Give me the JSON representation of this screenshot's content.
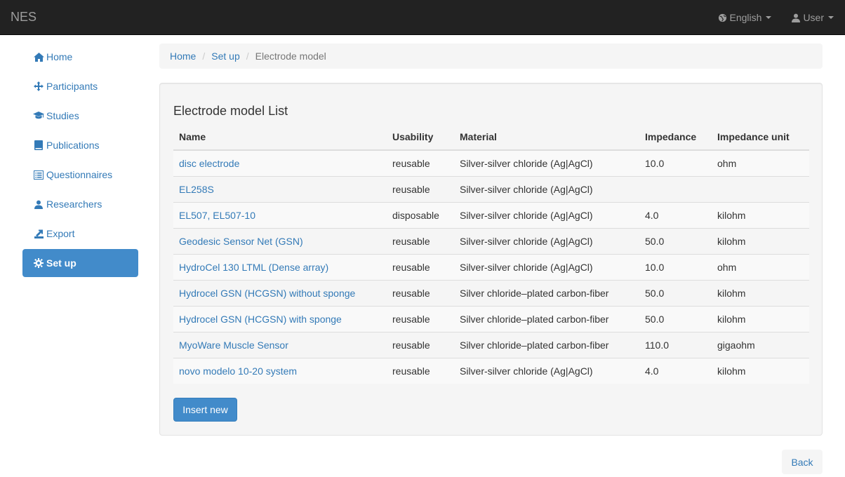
{
  "navbar": {
    "brand": "NES",
    "language_label": "English",
    "language_icon": "globe-icon",
    "user_label": "User",
    "user_icon": "user-icon"
  },
  "sidebar": {
    "items": [
      {
        "label": "Home",
        "icon": "home-icon"
      },
      {
        "label": "Participants",
        "icon": "move-icon"
      },
      {
        "label": "Studies",
        "icon": "education-icon"
      },
      {
        "label": "Publications",
        "icon": "book-icon"
      },
      {
        "label": "Questionnaires",
        "icon": "list-alt-icon"
      },
      {
        "label": "Researchers",
        "icon": "user-icon"
      },
      {
        "label": "Export",
        "icon": "export-icon"
      },
      {
        "label": "Set up",
        "icon": "cog-icon",
        "active": true
      }
    ]
  },
  "breadcrumb": {
    "items": [
      "Home",
      "Set up"
    ],
    "current": "Electrode model"
  },
  "list": {
    "title": "Electrode model List",
    "columns": [
      "Name",
      "Usability",
      "Material",
      "Impedance",
      "Impedance unit"
    ],
    "rows": [
      [
        "disc electrode",
        "reusable",
        "Silver-silver chloride (Ag|AgCl)",
        "10.0",
        "ohm"
      ],
      [
        "EL258S",
        "reusable",
        "Silver-silver chloride (Ag|AgCl)",
        "",
        ""
      ],
      [
        "EL507, EL507-10",
        "disposable",
        "Silver-silver chloride (Ag|AgCl)",
        "4.0",
        "kilohm"
      ],
      [
        "Geodesic Sensor Net (GSN)",
        "reusable",
        "Silver-silver chloride (Ag|AgCl)",
        "50.0",
        "kilohm"
      ],
      [
        "HydroCel 130 LTML (Dense array)",
        "reusable",
        "Silver-silver chloride (Ag|AgCl)",
        "10.0",
        "ohm"
      ],
      [
        "Hydrocel GSN (HCGSN) without sponge",
        "reusable",
        "Silver chloride–plated carbon-fiber",
        "50.0",
        "kilohm"
      ],
      [
        "Hydrocel GSN (HCGSN) with sponge",
        "reusable",
        "Silver chloride–plated carbon-fiber",
        "50.0",
        "kilohm"
      ],
      [
        "MyoWare Muscle Sensor",
        "reusable",
        "Silver chloride–plated carbon-fiber",
        "110.0",
        "gigaohm"
      ],
      [
        "novo modelo 10-20 system",
        "reusable",
        "Silver-silver chloride (Ag|AgCl)",
        "4.0",
        "kilohm"
      ]
    ],
    "insert_label": "Insert new"
  },
  "back_label": "Back",
  "colors": {
    "navbar_bg": "#222222",
    "link": "#337ab7",
    "primary": "#428bca"
  }
}
